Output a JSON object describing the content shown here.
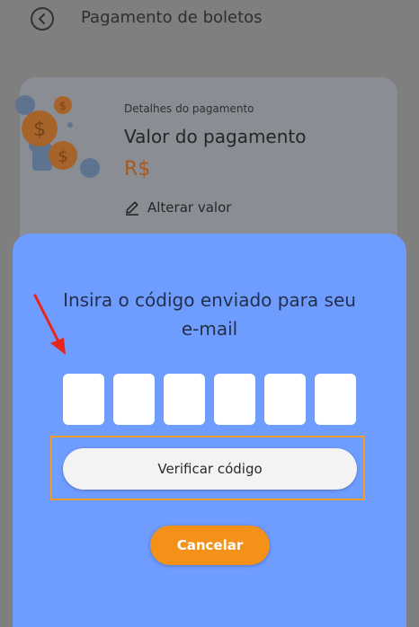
{
  "header": {
    "title": "Pagamento de boletos",
    "back_icon": "back-circle-icon"
  },
  "payment_card": {
    "caption": "Detalhes do pagamento",
    "title": "Valor do pagamento",
    "currency": "R$",
    "edit_label": "Alterar valor",
    "edit_icon": "pencil-icon",
    "illustration_icon": "coins-icon"
  },
  "code_modal": {
    "title": "Insira o código enviado para seu e-mail",
    "code_digits": [
      "",
      "",
      "",
      "",
      "",
      ""
    ],
    "verify_label": "Verificar código",
    "cancel_label": "Cancelar"
  },
  "colors": {
    "modal_background": "#6f9cff",
    "accent_orange": "#f39119",
    "highlight_border": "#f29a2e",
    "annotation_arrow": "#e8241c"
  }
}
